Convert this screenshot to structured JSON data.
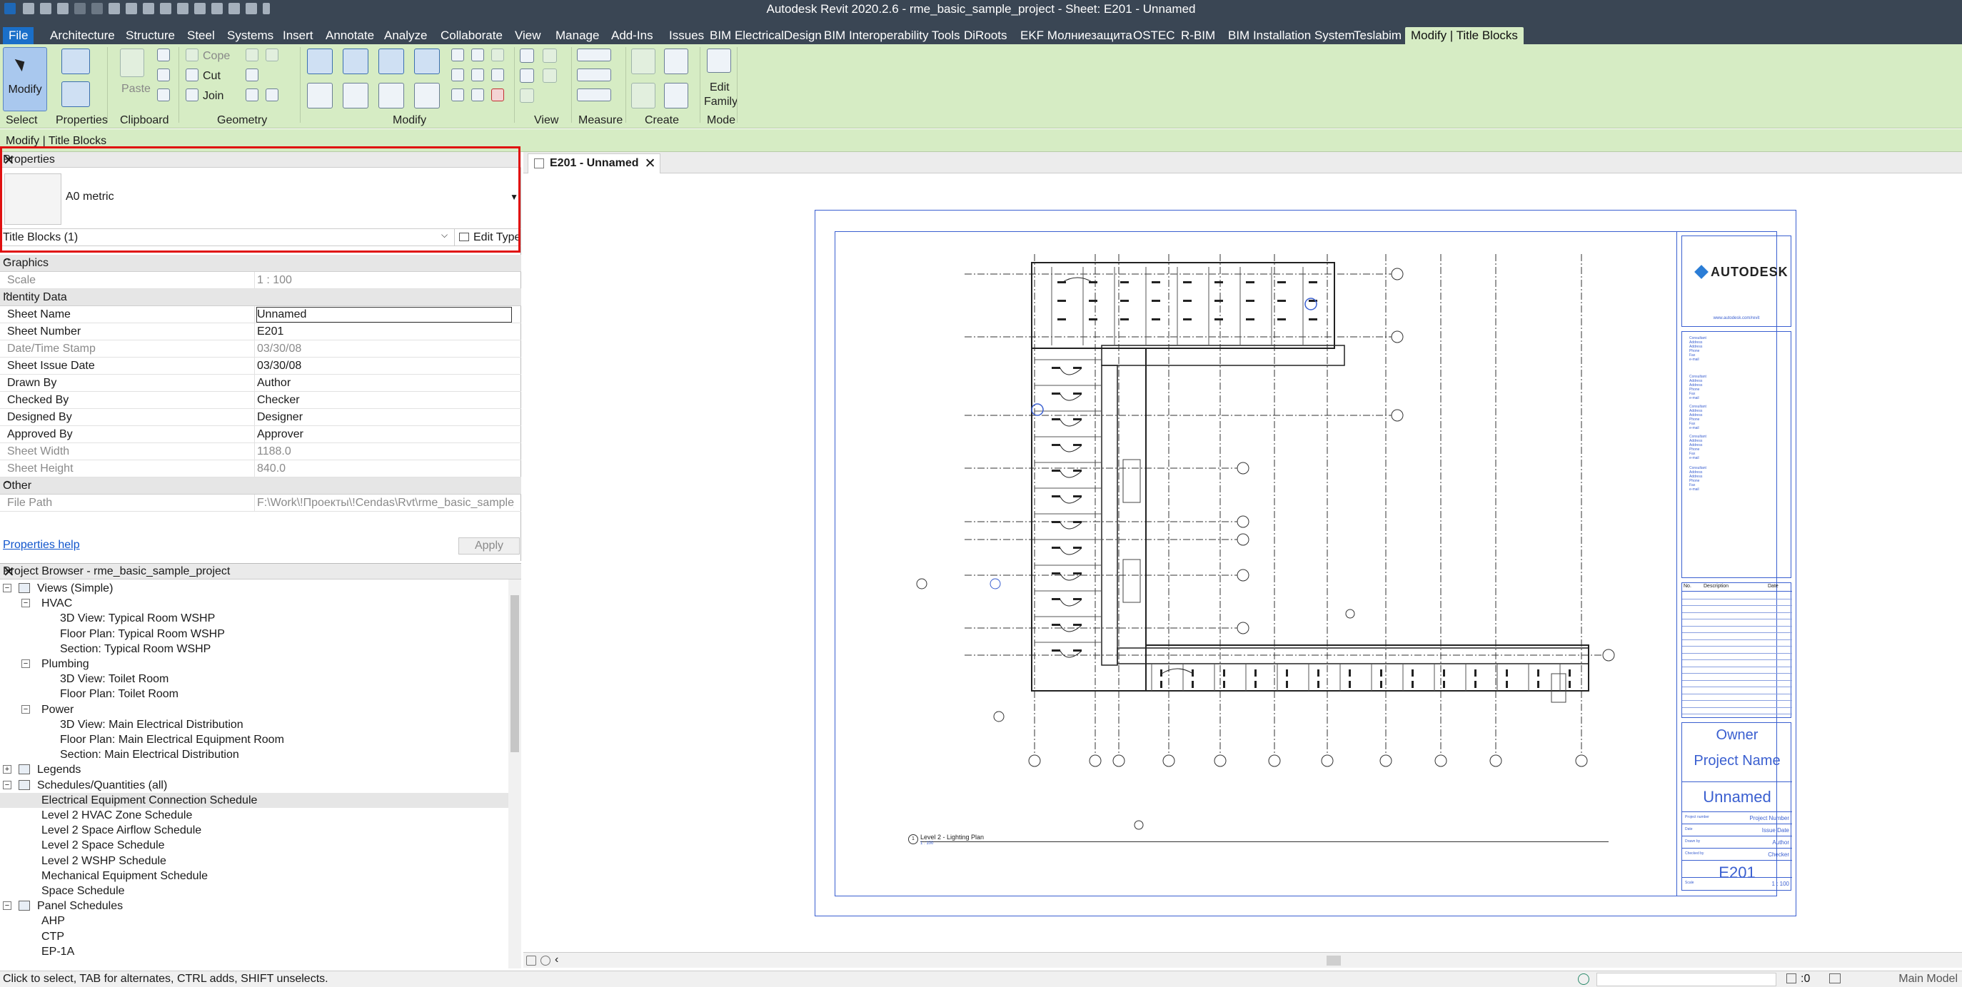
{
  "window": {
    "title": "Autodesk Revit 2020.2.6 - rme_basic_sample_project - Sheet: E201 - Unnamed"
  },
  "tabs": [
    "File",
    "Architecture",
    "Structure",
    "Steel",
    "Systems",
    "Insert",
    "Annotate",
    "Analyze",
    "Collaborate",
    "View",
    "Manage",
    "Add-Ins",
    "Issues",
    "BIM ElectricalDesign",
    "BIM Interoperability Tools",
    "DiRoots",
    "EKF Молниезащита",
    "OSTEC",
    "R-BIM",
    "BIM Installation System",
    "Teslabim",
    "Modify | Title Blocks"
  ],
  "ribbon": {
    "modify_label": "Modify",
    "paste_label": "Paste",
    "cope_label": "Cope",
    "cut_label": "Cut",
    "join_label": "Join",
    "edit_family_label_1": "Edit",
    "edit_family_label_2": "Family",
    "groups": [
      "Select",
      "Properties",
      "Clipboard",
      "Geometry",
      "Modify",
      "View",
      "Measure",
      "Create",
      "Mode"
    ]
  },
  "context_bar": {
    "label": "Modify | Title Blocks"
  },
  "properties": {
    "title": "Properties",
    "type_name": "A0 metric",
    "filter": "Title Blocks (1)",
    "edit_type": "Edit Type",
    "help": "Properties help",
    "apply": "Apply",
    "categories": {
      "graphics": "Graphics",
      "identity": "Identity Data",
      "other": "Other"
    },
    "graphics_rows": [
      {
        "k": "Scale",
        "v": "1 : 100"
      }
    ],
    "identity_rows": [
      {
        "k": "Sheet Name",
        "v": "Unnamed"
      },
      {
        "k": "Sheet Number",
        "v": "E201"
      },
      {
        "k": "Date/Time Stamp",
        "v": "03/30/08"
      },
      {
        "k": "Sheet Issue Date",
        "v": "03/30/08"
      },
      {
        "k": "Drawn By",
        "v": "Author"
      },
      {
        "k": "Checked By",
        "v": "Checker"
      },
      {
        "k": "Designed By",
        "v": "Designer"
      },
      {
        "k": "Approved By",
        "v": "Approver"
      },
      {
        "k": "Sheet Width",
        "v": "1188.0"
      },
      {
        "k": "Sheet Height",
        "v": "840.0"
      }
    ],
    "other_rows": [
      {
        "k": "File Path",
        "v": "F:\\Work\\!Проекты\\!Cendas\\Rvt\\rme_basic_sample_..."
      }
    ]
  },
  "browser": {
    "title": "Project Browser - rme_basic_sample_project",
    "nodes": [
      {
        "label": "Views (Simple)",
        "level": 0,
        "tw": "−",
        "icon": true
      },
      {
        "label": "HVAC",
        "level": 1,
        "tw": "−"
      },
      {
        "label": "3D View: Typical Room WSHP",
        "level": 2
      },
      {
        "label": "Floor Plan: Typical Room WSHP",
        "level": 2
      },
      {
        "label": "Section: Typical Room WSHP",
        "level": 2
      },
      {
        "label": "Plumbing",
        "level": 1,
        "tw": "−"
      },
      {
        "label": "3D View: Toilet Room",
        "level": 2
      },
      {
        "label": "Floor Plan: Toilet Room",
        "level": 2
      },
      {
        "label": "Power",
        "level": 1,
        "tw": "−"
      },
      {
        "label": "3D View: Main Electrical Distribution",
        "level": 2
      },
      {
        "label": "Floor Plan: Main Electrical Equipment Room",
        "level": 2
      },
      {
        "label": "Section: Main Electrical Distribution",
        "level": 2
      },
      {
        "label": "Legends",
        "level": 0,
        "tw": "+",
        "icon": true
      },
      {
        "label": "Schedules/Quantities (all)",
        "level": 0,
        "tw": "−",
        "icon": true
      },
      {
        "label": "Electrical Equipment Connection Schedule",
        "level": 1,
        "selected": true
      },
      {
        "label": "Level 2 HVAC Zone Schedule",
        "level": 1
      },
      {
        "label": "Level 2 Space Airflow Schedule",
        "level": 1
      },
      {
        "label": "Level 2 Space Schedule",
        "level": 1
      },
      {
        "label": "Level 2 WSHP Schedule",
        "level": 1
      },
      {
        "label": "Mechanical Equipment Schedule",
        "level": 1
      },
      {
        "label": "Space Schedule",
        "level": 1
      },
      {
        "label": "Panel Schedules",
        "level": 0,
        "tw": "−",
        "icon": true
      },
      {
        "label": "AHP",
        "level": 1
      },
      {
        "label": "CTP",
        "level": 1
      },
      {
        "label": "EP-1A",
        "level": 1
      }
    ]
  },
  "view_tab": {
    "label": "E201 - Unnamed"
  },
  "sheet": {
    "brand": "AUTODESK",
    "url": "www.autodesk.com/revit",
    "consultants": [
      "Consultant",
      "Address",
      "Address",
      "Phone",
      "Fax",
      "e-mail"
    ],
    "rev_headers": [
      "No.",
      "Description",
      "Date"
    ],
    "owner": "Owner",
    "project_name": "Project Name",
    "sheet_name": "Unnamed",
    "rows": [
      {
        "l": "Project number",
        "r": "Project Number"
      },
      {
        "l": "Date",
        "r": "Issue Date"
      },
      {
        "l": "Drawn by",
        "r": "Author"
      },
      {
        "l": "Checked by",
        "r": "Checker"
      }
    ],
    "sheet_number": "E201",
    "scale_label": "Scale",
    "scale": "1 : 100",
    "view_title": "Level 2 - Lighting Plan",
    "view_scale": "1 : 100",
    "view_no": "1",
    "grid_cols": [
      "1",
      "2",
      "3",
      "4",
      "5",
      "6",
      "7",
      "8",
      "9",
      "10",
      "11"
    ],
    "grid_rows": [
      "A",
      "B",
      "C",
      "D",
      "E",
      "F",
      "G",
      "H",
      "I"
    ]
  },
  "status": {
    "text": "Click to select, TAB for alternates, CTRL adds, SHIFT unselects.",
    "zero": ":0",
    "model": "Main Model"
  }
}
